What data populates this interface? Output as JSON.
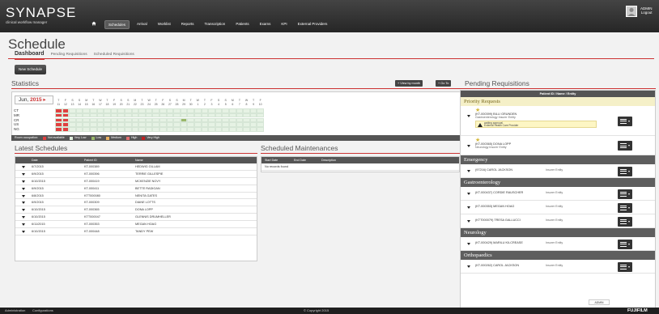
{
  "app": {
    "brand": "SYNAPSE",
    "tagline": "clinical workflow manager"
  },
  "nav": [
    "Schedules",
    "Arrival",
    "Worklist",
    "Reports",
    "Transcription",
    "Patients",
    "Exams",
    "KPI",
    "External Providers"
  ],
  "nav_active": 0,
  "user": {
    "line1": "ADMIN",
    "line2": "Logout"
  },
  "page": {
    "title": "Schedule"
  },
  "tabs": [
    "Dashboard",
    "Pending Requisitions",
    "Scheduled Requisitions"
  ],
  "new_schedule": "New Schedule",
  "statistics": {
    "heading": "Statistics",
    "view_by_month": "+ View by month",
    "go_to": "+ Go To",
    "month": "Jun,",
    "year": "2015",
    "weekdays": [
      "T",
      "F",
      "S",
      "S",
      "M",
      "T",
      "W",
      "T",
      "F",
      "S",
      "S",
      "M",
      "T",
      "W",
      "T",
      "F",
      "S",
      "S",
      "M",
      "T",
      "W",
      "T",
      "F",
      "S",
      "S",
      "M",
      "T",
      "W",
      "T",
      "F"
    ],
    "days": [
      "11",
      "12",
      "13",
      "14",
      "15",
      "16",
      "17",
      "18",
      "19",
      "20",
      "21",
      "22",
      "23",
      "24",
      "25",
      "26",
      "27",
      "28",
      "29",
      "30",
      "1",
      "2",
      "3",
      "4",
      "5",
      "6",
      "7",
      "8",
      "9",
      "10"
    ],
    "modalities": [
      "CT",
      "MR",
      "CR",
      "US",
      "NG"
    ],
    "legend": [
      {
        "label": "Room occupation:",
        "color": ""
      },
      {
        "label": "Not available",
        "color": "#e04040"
      },
      {
        "label": "Very Low",
        "color": "#dfeedd"
      },
      {
        "label": "Low",
        "color": "#9ab86a"
      },
      {
        "label": "Medium",
        "color": "#e8b060"
      },
      {
        "label": "High",
        "color": "#e07070"
      },
      {
        "label": "Very High",
        "color": "#c02020"
      }
    ]
  },
  "latest_schedules": {
    "heading": "Latest Schedules",
    "columns": [
      "Date",
      "Patient ID",
      "Name"
    ],
    "rows": [
      [
        "6/7/2015",
        "KT-000389",
        "HEDWIG GILLAM"
      ],
      [
        "6/9/2015",
        "KT-000396",
        "TERRIE GILLESPIE"
      ],
      [
        "6/10/2015",
        "KT-000419",
        "MCKENZIE NOVY"
      ],
      [
        "6/9/2015",
        "KT-000411",
        "BETTE RADIGAN"
      ],
      [
        "6/8/2015",
        "KTT000080",
        "NENITA GATES"
      ],
      [
        "6/9/2015",
        "KT-000309",
        "DIANE LOTTS"
      ],
      [
        "6/10/2015",
        "KT-000365",
        "DONA LOPP"
      ],
      [
        "6/10/2015",
        "KTT000047",
        "GLENNIS DRUMHELLER"
      ],
      [
        "6/11/2015",
        "KT-000353",
        "MEGAN HOAG"
      ],
      [
        "6/10/2015",
        "KT-000448",
        "TANDY PEW"
      ]
    ]
  },
  "scheduled_maintenances": {
    "heading": "Scheduled Maintenances",
    "columns": [
      "Start Date",
      "End Date",
      "Description"
    ],
    "empty": "No records found"
  },
  "pending_requisitions": {
    "heading": "Pending Requisitions",
    "column": "Patient ID / Name / Entity",
    "groups": [
      {
        "name": "Priority Requests",
        "priority": true,
        "items": [
          {
            "id": "(KT-000399) BILLI GRUNDEN",
            "entity": "Gastroenterology Insurer Entity",
            "star": true,
            "warning": [
              "waiting approval",
              "External Health Care Provider"
            ]
          },
          {
            "id": "(KT-000365) DONA LOPP",
            "entity": "Neurology Insurer Entity",
            "star": true
          }
        ]
      },
      {
        "name": "Emergency",
        "items": [
          {
            "id": "(97216) CAROL JACKSON",
            "entity": "Insurer Entity"
          }
        ]
      },
      {
        "name": "Gastroenterology",
        "items": [
          {
            "id": "(KT-000437) CORDIE RAUSCHER",
            "entity": "Insurer Entity"
          },
          {
            "id": "(KT-000353) MEGAN HOAG",
            "entity": "Insurer Entity"
          },
          {
            "id": "(KTT000079) TRESA GALLUCCI",
            "entity": "Insurer Entity"
          }
        ]
      },
      {
        "name": "Neurology",
        "items": [
          {
            "id": "(KT-000429) MARILU KILCREASE",
            "entity": "Insurer Entity"
          }
        ]
      },
      {
        "name": "Orthopaedics",
        "items": [
          {
            "id": "(KT-000262) CAROL JACKSON",
            "entity": "Insurer Entity"
          }
        ]
      }
    ]
  },
  "footer": {
    "left1": "Administration",
    "left2": "Configurations",
    "center": "© Copyright 2015",
    "right": "FUJIFILM",
    "badge": "ADMIN"
  },
  "colors": {
    "accent": "#cc3333",
    "nav_bg": "#333333",
    "cell_free": "#e6f2e4",
    "cell_unavail": "#e04040",
    "cell_low": "#9ab86a"
  }
}
